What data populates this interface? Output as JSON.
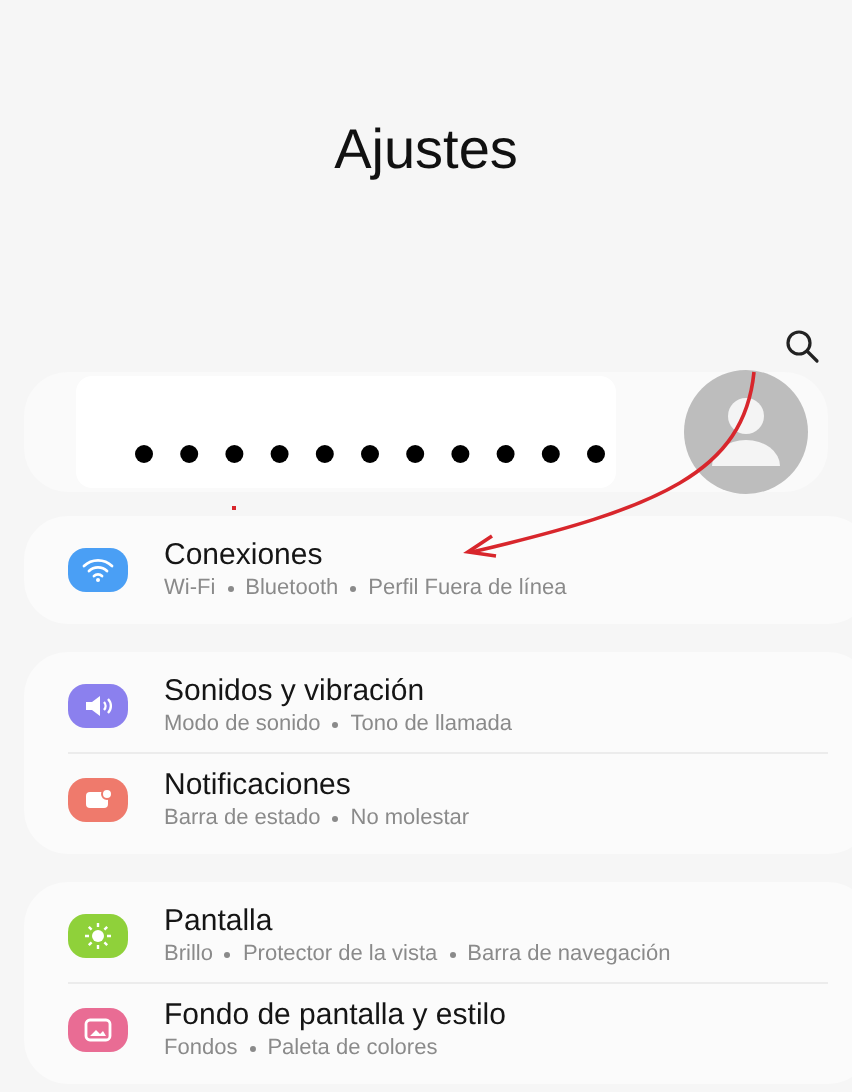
{
  "header": {
    "title": "Ajustes"
  },
  "groups": [
    {
      "items": [
        {
          "kind": "wifi",
          "color": "#4a9ff5",
          "title": "Conexiones",
          "subtitle": [
            "Wi-Fi",
            "Bluetooth",
            "Perfil Fuera de línea"
          ]
        }
      ]
    },
    {
      "items": [
        {
          "kind": "sound",
          "color": "#8b80ee",
          "title": "Sonidos y vibración",
          "subtitle": [
            "Modo de sonido",
            "Tono de llamada"
          ]
        },
        {
          "kind": "notification",
          "color": "#ef7a6c",
          "title": "Notificaciones",
          "subtitle": [
            "Barra de estado",
            "No molestar"
          ]
        }
      ]
    },
    {
      "items": [
        {
          "kind": "display",
          "color": "#8fd13a",
          "title": "Pantalla",
          "subtitle": [
            "Brillo",
            "Protector de la vista",
            "Barra de navegación"
          ]
        },
        {
          "kind": "wallpaper",
          "color": "#e96c94",
          "title": "Fondo de pantalla y estilo",
          "subtitle": [
            "Fondos",
            "Paleta de colores"
          ]
        }
      ]
    }
  ]
}
